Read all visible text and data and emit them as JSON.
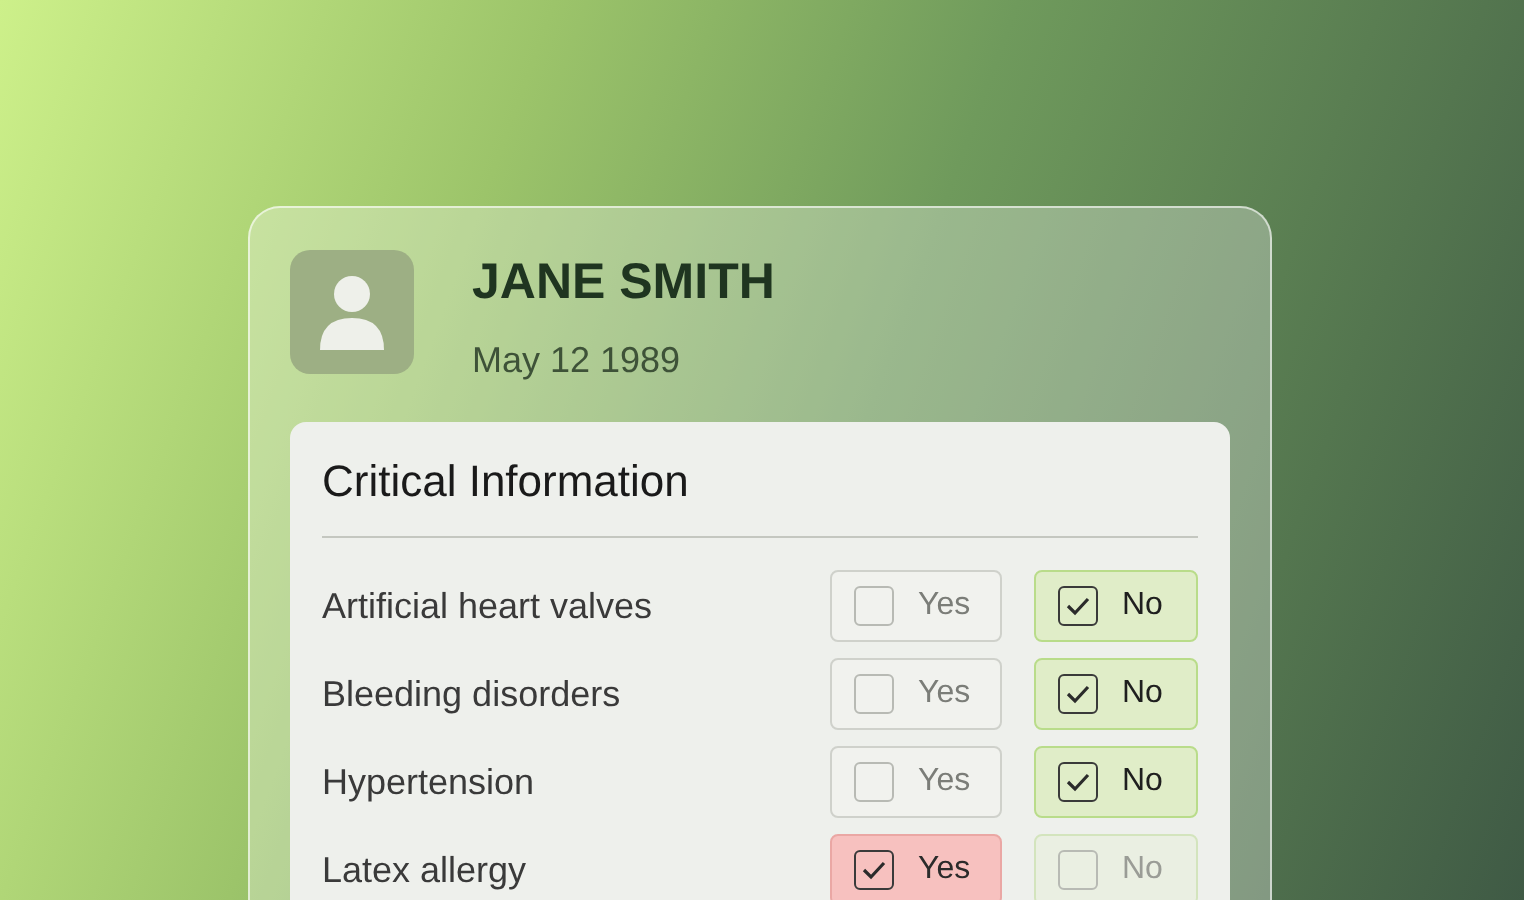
{
  "patient": {
    "name": "JANE SMITH",
    "birth_date": "May 12 1989"
  },
  "section": {
    "title": "Critical Information",
    "rows": [
      {
        "label": "Artificial heart valves",
        "options": [
          {
            "kind": "yes",
            "label": "Yes",
            "checked": false
          },
          {
            "kind": "no",
            "label": "No",
            "checked": true
          }
        ]
      },
      {
        "label": "Bleeding disorders",
        "options": [
          {
            "kind": "yes",
            "label": "Yes",
            "checked": false
          },
          {
            "kind": "no",
            "label": "No",
            "checked": true
          }
        ]
      },
      {
        "label": "Hypertension",
        "options": [
          {
            "kind": "yes",
            "label": "Yes",
            "checked": false
          },
          {
            "kind": "no",
            "label": "No",
            "checked": true
          }
        ]
      },
      {
        "label": "Latex allergy",
        "options": [
          {
            "kind": "yes",
            "label": "Yes",
            "checked": true
          },
          {
            "kind": "no",
            "label": "No",
            "checked": false
          }
        ]
      }
    ]
  }
}
